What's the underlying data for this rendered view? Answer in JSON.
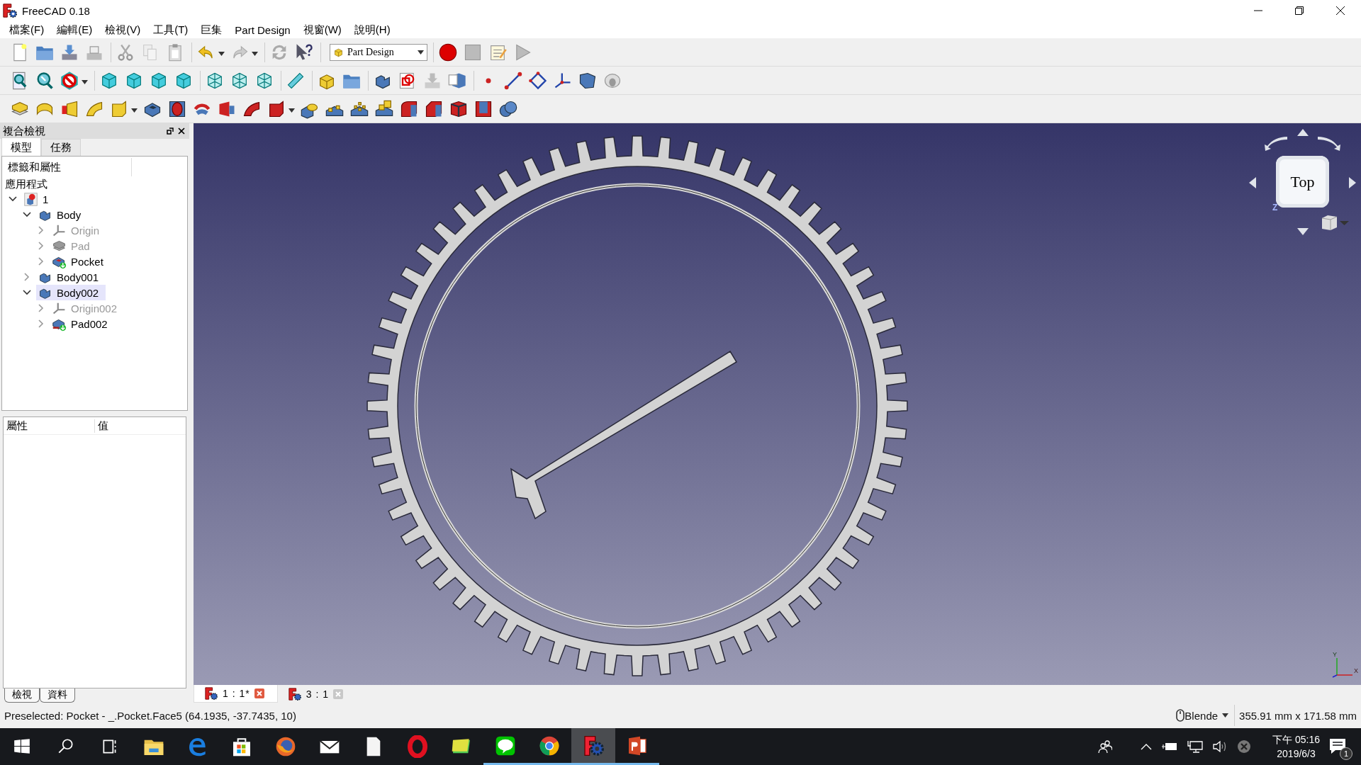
{
  "window": {
    "title": "FreeCAD 0.18"
  },
  "menu": [
    "檔案(F)",
    "編輯(E)",
    "檢視(V)",
    "工具(T)",
    "巨集",
    "Part Design",
    "視窗(W)",
    "說明(H)"
  ],
  "workbench_selector": {
    "value": "Part Design"
  },
  "combo_view": {
    "title": "複合檢視",
    "tabs": [
      {
        "label": "模型",
        "selected": true
      },
      {
        "label": "任務",
        "selected": false
      }
    ],
    "tree": {
      "header": "標籤和屬性",
      "root_label": "應用程式",
      "items": [
        {
          "label": "1",
          "kind": "document",
          "expanded": true,
          "visible": true,
          "selected": false,
          "children": [
            {
              "label": "Body",
              "kind": "body",
              "expanded": true,
              "visible": true,
              "selected": false,
              "children": [
                {
                  "label": "Origin",
                  "kind": "origin",
                  "expanded": false,
                  "visible": false,
                  "selected": false
                },
                {
                  "label": "Pad",
                  "kind": "pad",
                  "expanded": false,
                  "visible": false,
                  "selected": false
                },
                {
                  "label": "Pocket",
                  "kind": "pocket",
                  "expanded": false,
                  "visible": true,
                  "selected": false
                }
              ]
            },
            {
              "label": "Body001",
              "kind": "body",
              "expanded": false,
              "visible": true,
              "selected": false
            },
            {
              "label": "Body002",
              "kind": "body",
              "expanded": true,
              "visible": true,
              "selected": true,
              "children": [
                {
                  "label": "Origin002",
                  "kind": "origin",
                  "expanded": false,
                  "visible": false,
                  "selected": false
                },
                {
                  "label": "Pad002",
                  "kind": "pad",
                  "expanded": false,
                  "visible": true,
                  "selected": false
                }
              ]
            }
          ]
        }
      ]
    },
    "properties": {
      "columns": [
        "屬性",
        "值"
      ]
    },
    "bottom_tabs": [
      "檢視",
      "資料"
    ]
  },
  "viewport": {
    "nav_cube": {
      "face": "Top",
      "axis": "Z"
    },
    "axis_labels": [
      "Y",
      "X"
    ]
  },
  "document_tabs": [
    {
      "label": "1 : 1*",
      "selected": true
    },
    {
      "label": "3 : 1",
      "selected": false
    }
  ],
  "status_bar": {
    "message": "Preselected: Pocket - _.Pocket.Face5 (64.1935, -37.7435, 10)",
    "navigation_style": "Blende",
    "dimensions": "355.91 mm x 171.58 mm"
  },
  "taskbar": {
    "apps": [
      {
        "kind": "explorer",
        "running": false,
        "active": false
      },
      {
        "kind": "edge",
        "running": false,
        "active": false
      },
      {
        "kind": "store",
        "running": false,
        "active": false
      },
      {
        "kind": "firefox",
        "running": false,
        "active": false
      },
      {
        "kind": "mail",
        "running": false,
        "active": false
      },
      {
        "kind": "file",
        "running": false,
        "active": false
      },
      {
        "kind": "opera",
        "running": false,
        "active": false
      },
      {
        "kind": "notes",
        "running": false,
        "active": false
      },
      {
        "kind": "line",
        "running": true,
        "active": false
      },
      {
        "kind": "chrome",
        "running": true,
        "active": false
      },
      {
        "kind": "freecad",
        "running": true,
        "active": true
      },
      {
        "kind": "powerpoint",
        "running": true,
        "active": false
      }
    ],
    "clock": {
      "time": "下午 05:16",
      "date": "2019/6/3"
    },
    "notifications": "1"
  }
}
